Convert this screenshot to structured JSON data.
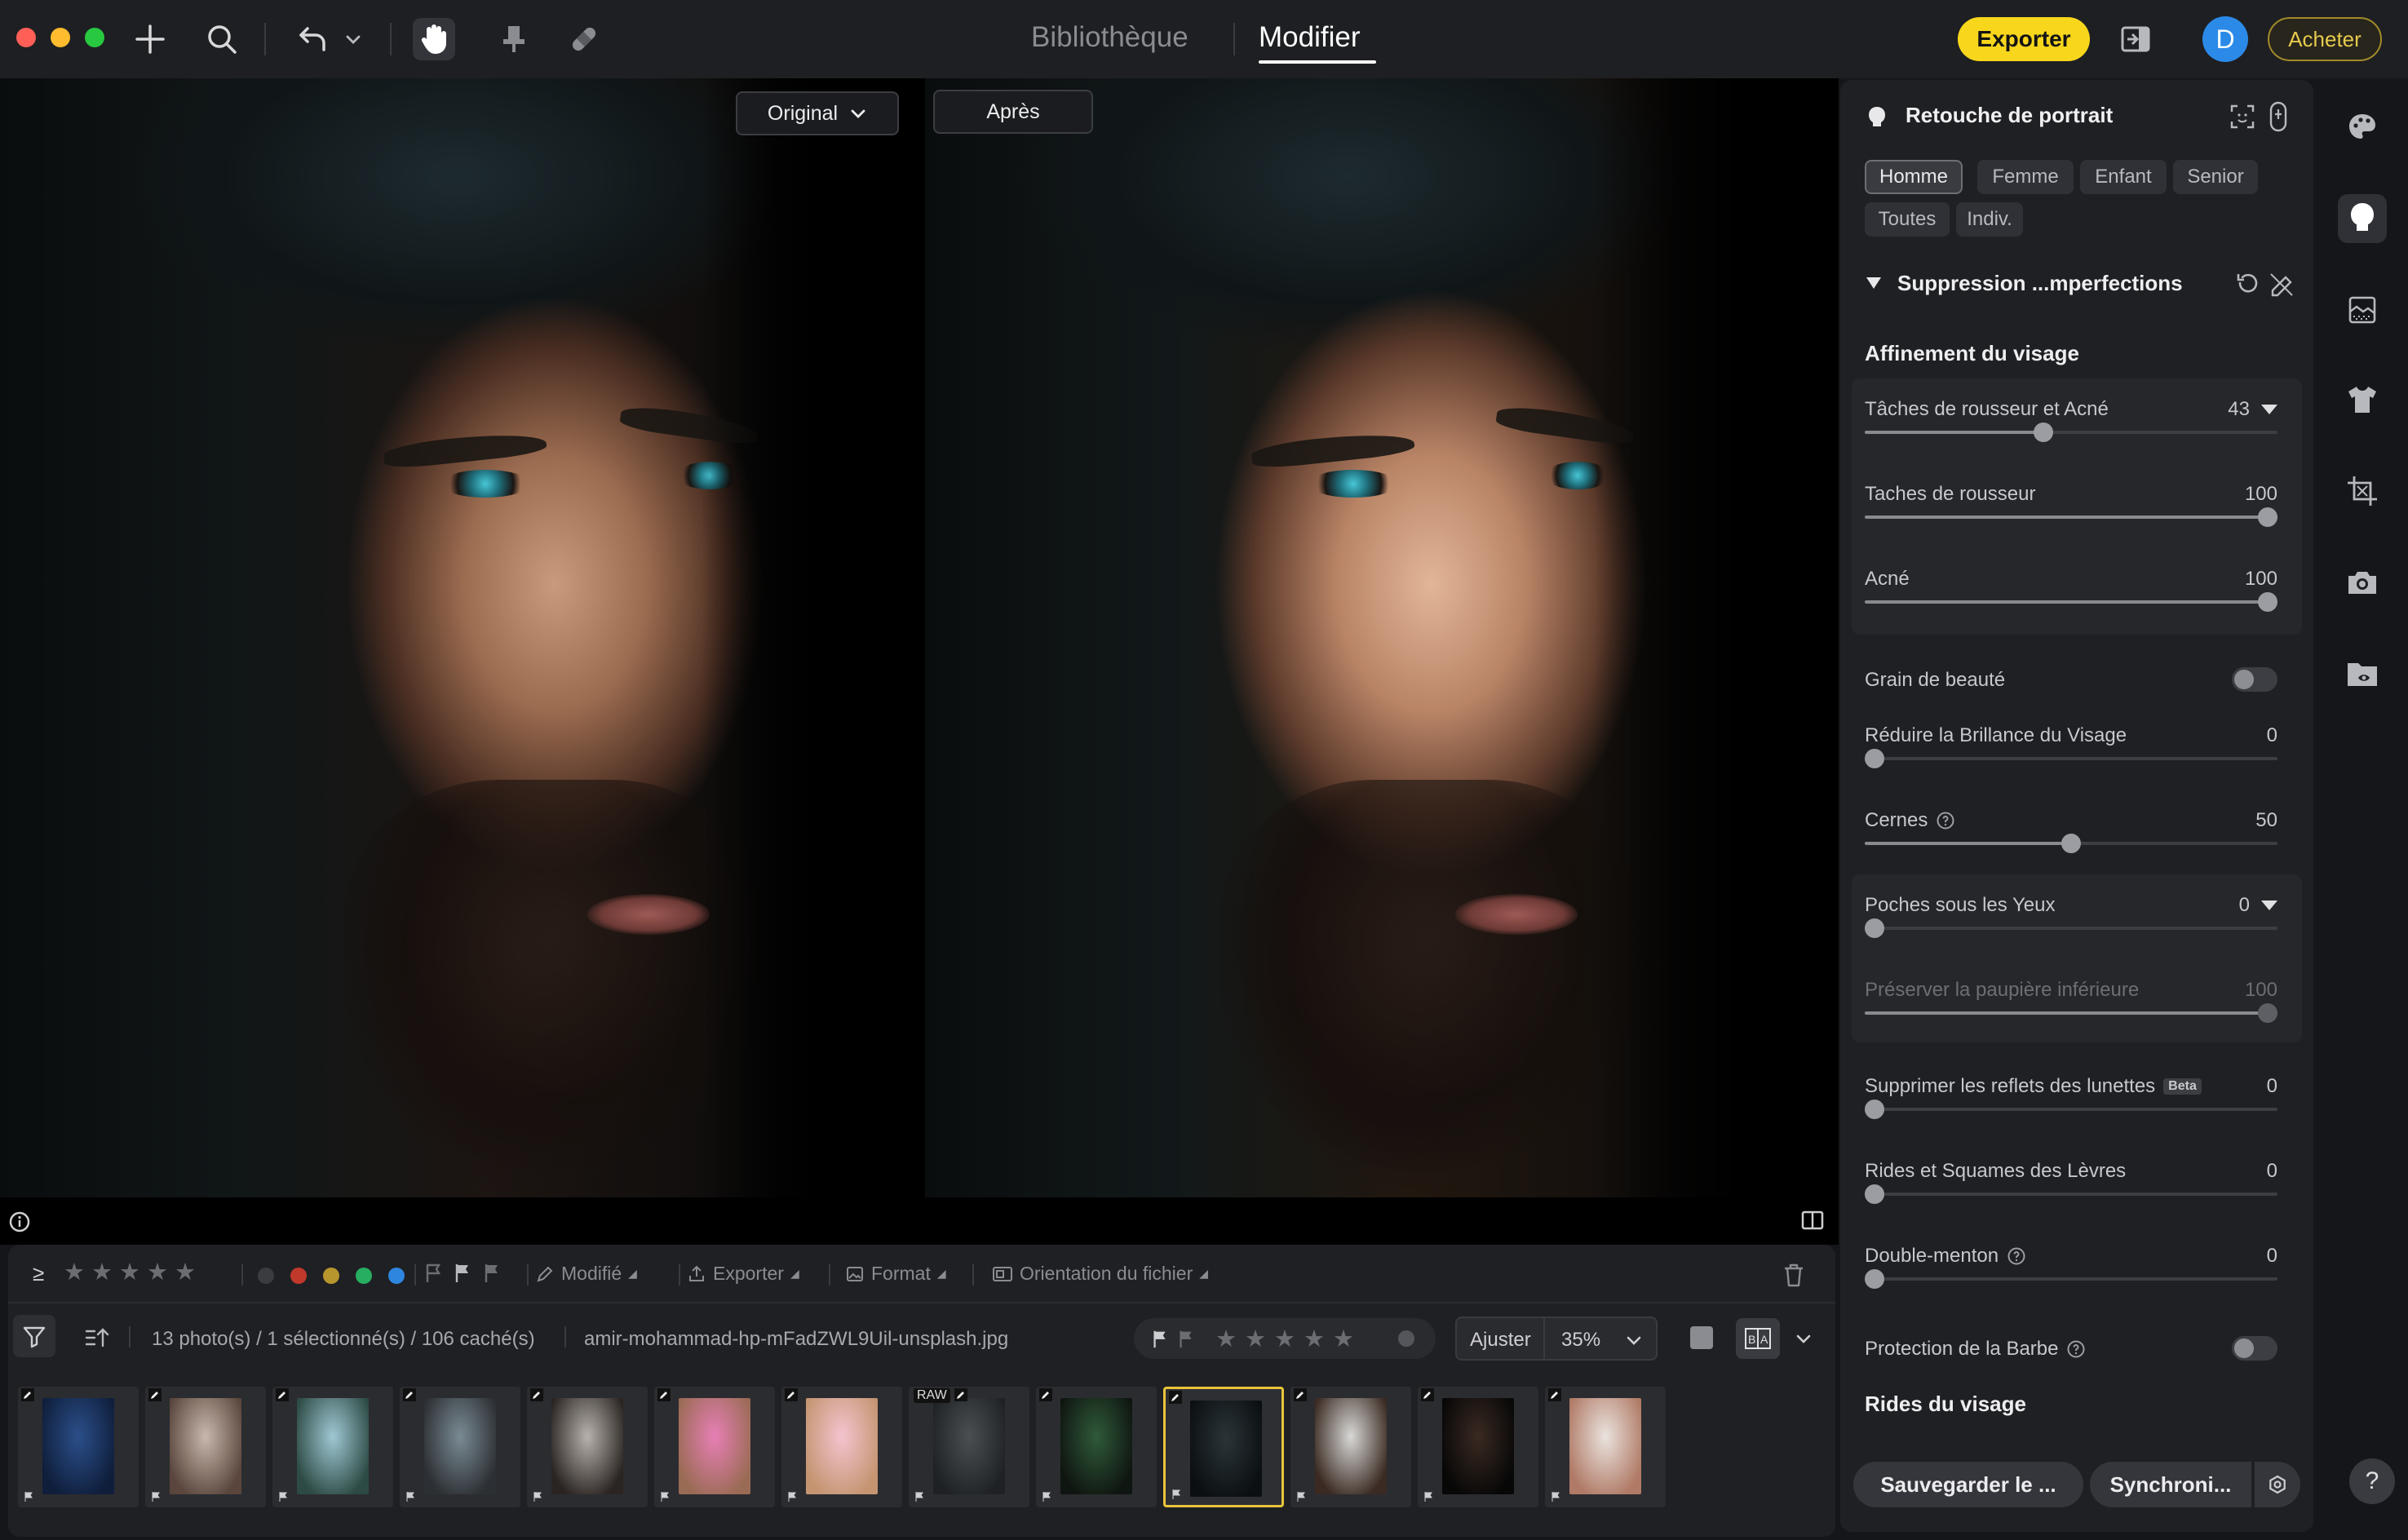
{
  "window": {
    "traffic_colors": [
      "#ff5f57",
      "#febc2e",
      "#28c840"
    ]
  },
  "toolbar": {
    "tools": [
      "add-icon",
      "search-icon",
      "undo-icon",
      "chevron-down-icon",
      "hand-icon",
      "stamp-icon",
      "bandage-icon"
    ],
    "modes": [
      {
        "label": "Bibliothèque",
        "active": false
      },
      {
        "label": "Modifier",
        "active": true
      }
    ],
    "export_label": "Exporter",
    "avatar_initial": "D",
    "buy_label": "Acheter",
    "accent": "#f8d61c"
  },
  "left_tools": [
    "ai-mask-icon",
    "radial-mask-icon",
    "history-icon"
  ],
  "canvas": {
    "before_label": "Original",
    "after_label": "Après"
  },
  "bottom": {
    "filters": {
      "modified_label": "Modifié",
      "export_label": "Exporter",
      "format_label": "Format",
      "orientation_label": "Orientation du fichier",
      "color_labels": [
        "#3b3c40",
        "#c0392b",
        "#b8962e",
        "#27ae60",
        "#2e86de"
      ]
    },
    "status": "13 photo(s) / 1 sélectionné(s) / 106 caché(s)",
    "filename": "amir-mohammad-hp-mFadZWL9Uil-unsplash.jpg",
    "zoom_mode": "Ajuster",
    "zoom_value": "35%",
    "thumbnails": [
      {
        "colors": [
          "#2b4f8a",
          "#0f1e3b"
        ],
        "edited": true,
        "raw": false,
        "selected": false
      },
      {
        "colors": [
          "#c8b8ad",
          "#5a463c"
        ],
        "edited": true,
        "raw": false,
        "selected": false
      },
      {
        "colors": [
          "#9fc8d4",
          "#2d4a44"
        ],
        "edited": true,
        "raw": false,
        "selected": false
      },
      {
        "colors": [
          "#7a8b94",
          "#2c2f33"
        ],
        "edited": true,
        "raw": false,
        "selected": false
      },
      {
        "colors": [
          "#b7b2ad",
          "#2a2522"
        ],
        "edited": true,
        "raw": false,
        "selected": false
      },
      {
        "colors": [
          "#e77fb5",
          "#9a6b54"
        ],
        "edited": true,
        "raw": false,
        "selected": false
      },
      {
        "colors": [
          "#f3c4cf",
          "#c59572"
        ],
        "edited": true,
        "raw": false,
        "selected": false
      },
      {
        "colors": [
          "#4b4f52",
          "#1e2224"
        ],
        "edited": true,
        "raw": true,
        "selected": false
      },
      {
        "colors": [
          "#2f5a3a",
          "#0f1510"
        ],
        "edited": true,
        "raw": false,
        "selected": false
      },
      {
        "colors": [
          "#2a3438",
          "#0b0f11"
        ],
        "edited": true,
        "raw": false,
        "selected": true
      },
      {
        "colors": [
          "#d8d8d6",
          "#3a2a22"
        ],
        "edited": true,
        "raw": false,
        "selected": false
      },
      {
        "colors": [
          "#3a2a22",
          "#070707"
        ],
        "edited": true,
        "raw": false,
        "selected": false
      },
      {
        "colors": [
          "#eae3de",
          "#b07a66"
        ],
        "edited": true,
        "raw": false,
        "selected": false
      }
    ]
  },
  "panel": {
    "title": "Retouche de portrait",
    "presets": [
      "Homme",
      "Femme",
      "Enfant",
      "Senior",
      "Toutes",
      "Indiv."
    ],
    "active_preset": "Homme",
    "section_title": "Suppression ...mperfections",
    "subsection_1": "Affinement du visage",
    "subsection_2": "Rides du visage",
    "sliders": {
      "taches_acne": {
        "label": "Tâches de rousseur et Acné",
        "value": "43",
        "fraction": 0.43
      },
      "taches_rousseur": {
        "label": "Taches de rousseur",
        "value": "100",
        "fraction": 1.0
      },
      "acne": {
        "label": "Acné",
        "value": "100",
        "fraction": 1.0
      },
      "brillance": {
        "label": "Réduire la Brillance du Visage",
        "value": "0",
        "fraction": 0.0
      },
      "cernes": {
        "label": "Cernes",
        "value": "50",
        "fraction": 0.5
      },
      "poches": {
        "label": "Poches sous les Yeux",
        "value": "0",
        "fraction": 0.0
      },
      "paupiere": {
        "label": "Préserver la paupière inférieure",
        "value": "100",
        "fraction": 1.0
      },
      "reflets": {
        "label": "Supprimer les reflets des lunettes",
        "badge": "Beta",
        "value": "0",
        "fraction": 0.0
      },
      "levres": {
        "label": "Rides et Squames des Lèvres",
        "value": "0",
        "fraction": 0.0
      },
      "menton": {
        "label": "Double-menton",
        "value": "0",
        "fraction": 0.0
      }
    },
    "toggles": {
      "grain": {
        "label": "Grain de beauté",
        "on": false
      },
      "barbe": {
        "label": "Protection de la Barbe",
        "on": false
      }
    },
    "save_label": "Sauvegarder le ...",
    "sync_label": "Synchroni..."
  },
  "rail": [
    "palette-icon",
    "portrait-icon",
    "texture-icon",
    "shirt-icon",
    "crop-icon",
    "camera-icon",
    "folder-eye-icon"
  ],
  "help_label": "?"
}
